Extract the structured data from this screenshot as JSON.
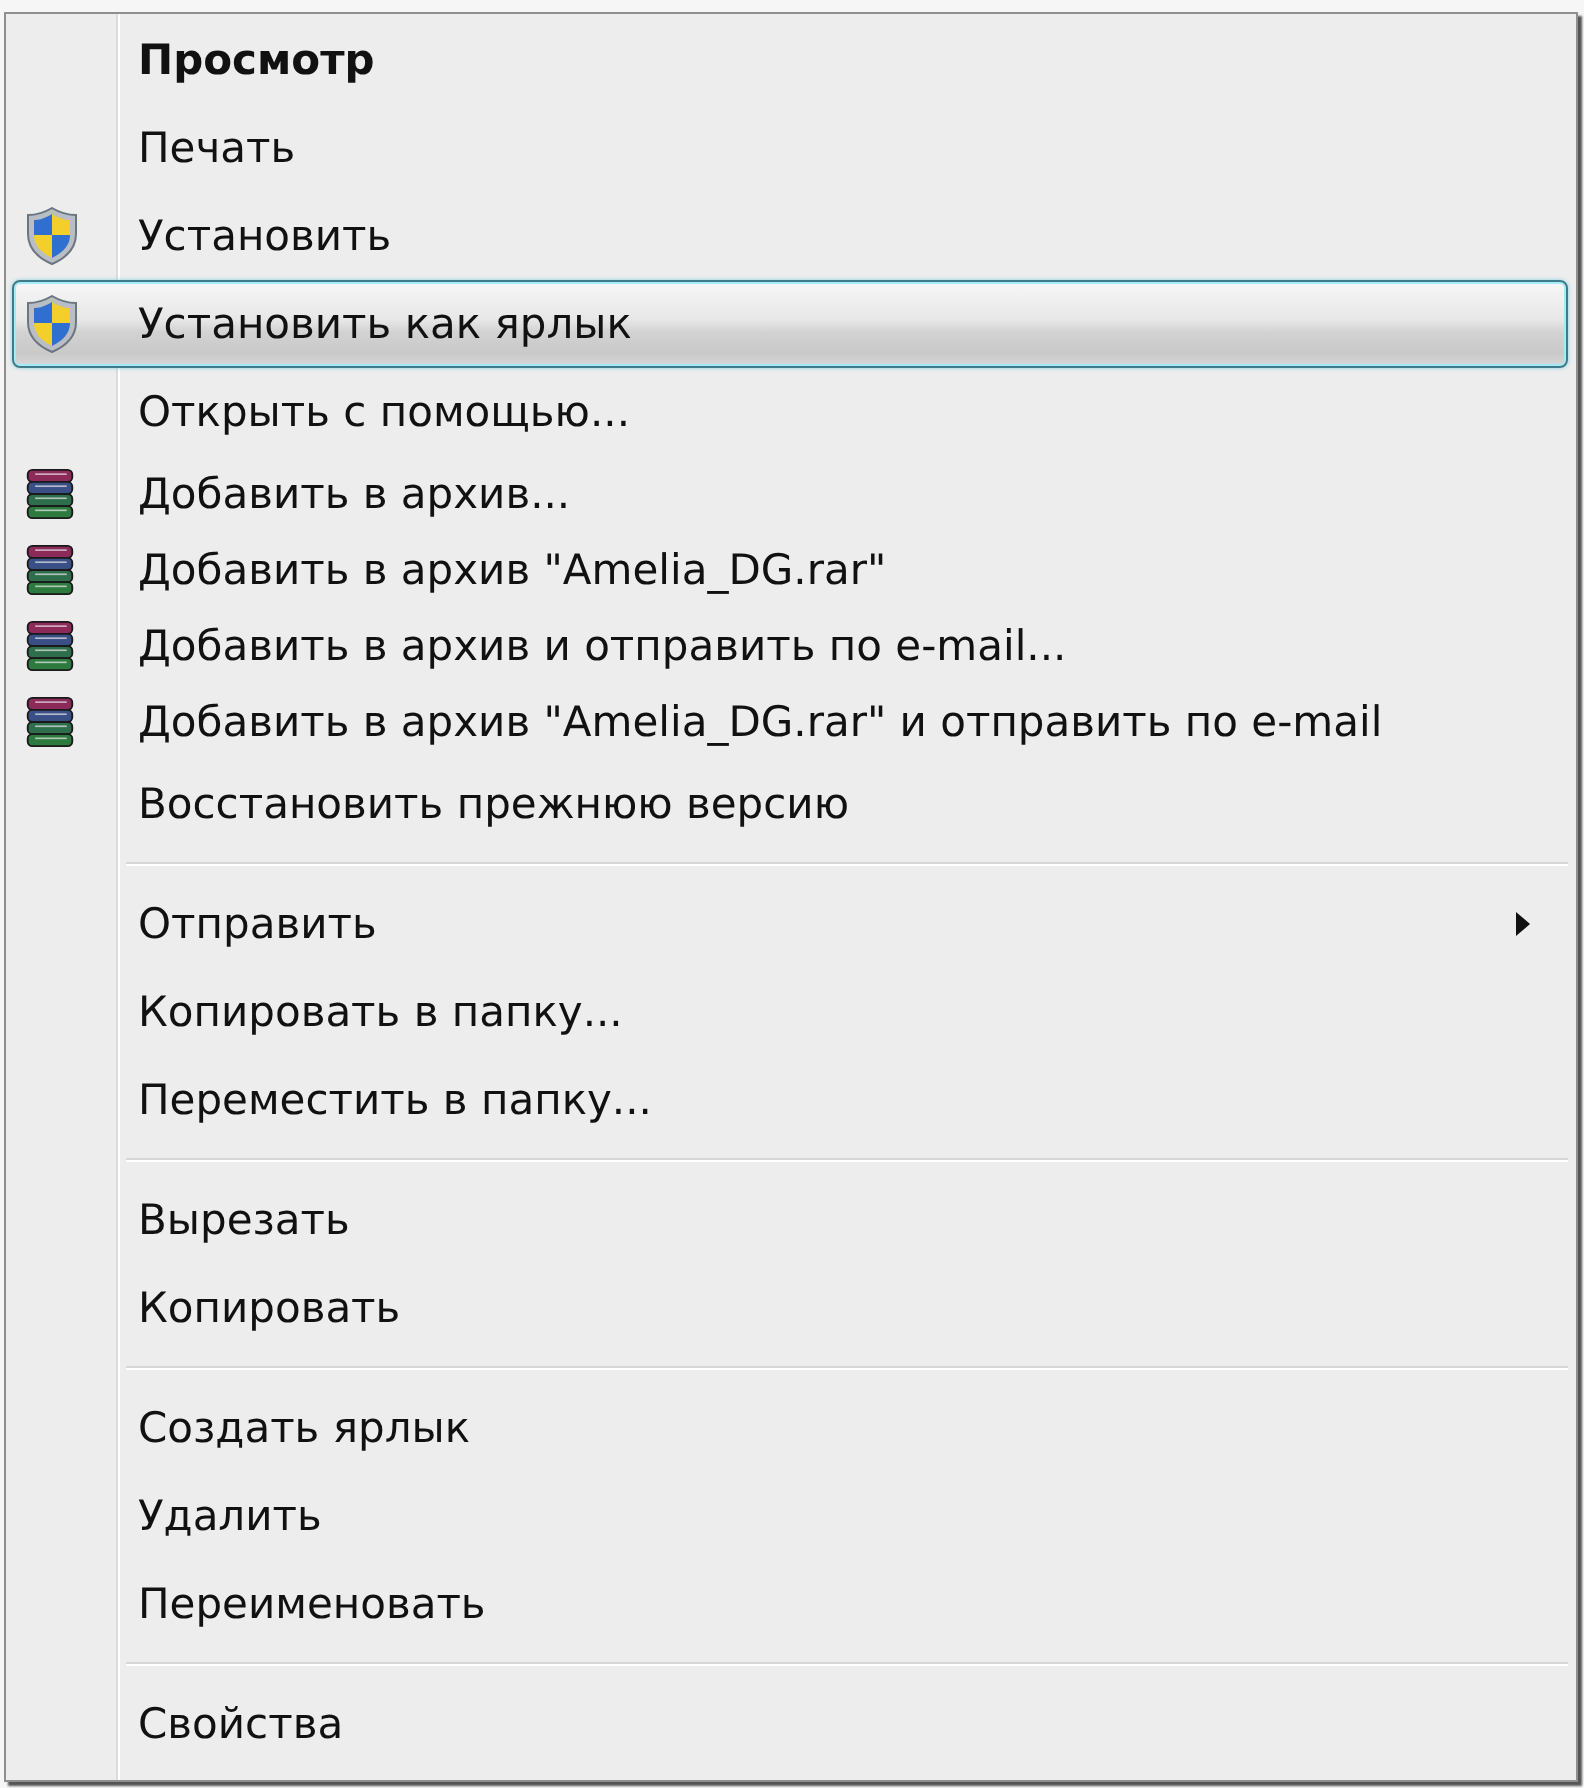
{
  "menu": {
    "groups": [
      {
        "items": [
          {
            "label": "Просмотр",
            "kind": "plain",
            "default": true,
            "selected": false,
            "submenu": false
          },
          {
            "label": "Печать",
            "kind": "plain",
            "default": false,
            "selected": false,
            "submenu": false
          },
          {
            "label": "Установить",
            "kind": "uac",
            "default": false,
            "selected": false,
            "submenu": false
          },
          {
            "label": "Установить как ярлык",
            "kind": "uac",
            "default": false,
            "selected": true,
            "submenu": false
          },
          {
            "label": "Открыть с помощью...",
            "kind": "plain",
            "default": false,
            "selected": false,
            "submenu": false
          },
          {
            "label": "Добавить в архив...",
            "kind": "archive",
            "default": false,
            "selected": false,
            "submenu": false
          },
          {
            "label": "Добавить в архив \"Amelia_DG.rar\"",
            "kind": "archive",
            "default": false,
            "selected": false,
            "submenu": false
          },
          {
            "label": "Добавить в архив и отправить по e-mail...",
            "kind": "archive",
            "default": false,
            "selected": false,
            "submenu": false
          },
          {
            "label": "Добавить в архив \"Amelia_DG.rar\" и отправить по e-mail",
            "kind": "archive",
            "default": false,
            "selected": false,
            "submenu": false
          },
          {
            "label": "Восстановить прежнюю версию",
            "kind": "plain",
            "default": false,
            "selected": false,
            "submenu": false
          }
        ]
      },
      {
        "items": [
          {
            "label": "Отправить",
            "kind": "plain",
            "default": false,
            "selected": false,
            "submenu": true
          },
          {
            "label": "Копировать в папку...",
            "kind": "plain",
            "default": false,
            "selected": false,
            "submenu": false
          },
          {
            "label": "Переместить в папку...",
            "kind": "plain",
            "default": false,
            "selected": false,
            "submenu": false
          }
        ]
      },
      {
        "items": [
          {
            "label": "Вырезать",
            "kind": "plain",
            "default": false,
            "selected": false,
            "submenu": false
          },
          {
            "label": "Копировать",
            "kind": "plain",
            "default": false,
            "selected": false,
            "submenu": false
          }
        ]
      },
      {
        "items": [
          {
            "label": "Создать ярлык",
            "kind": "plain",
            "default": false,
            "selected": false,
            "submenu": false
          },
          {
            "label": "Удалить",
            "kind": "plain",
            "default": false,
            "selected": false,
            "submenu": false
          },
          {
            "label": "Переименовать",
            "kind": "plain",
            "default": false,
            "selected": false,
            "submenu": false
          }
        ]
      },
      {
        "items": [
          {
            "label": "Свойства",
            "kind": "plain",
            "default": false,
            "selected": false,
            "submenu": false
          }
        ]
      }
    ]
  }
}
